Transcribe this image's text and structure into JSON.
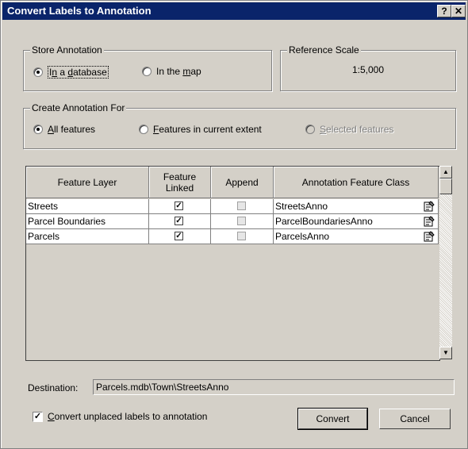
{
  "window": {
    "title": "Convert Labels to Annotation",
    "help_button": "?",
    "close_button": "✕"
  },
  "store_annotation": {
    "legend": "Store Annotation",
    "options": [
      {
        "pre": "I",
        "acc": "n",
        "post": " a ",
        "acc2": "d",
        "post2": "atabase",
        "selected": true
      },
      {
        "pre": "In the ",
        "acc": "m",
        "post": "ap",
        "selected": false
      }
    ]
  },
  "reference_scale": {
    "legend": "Reference Scale",
    "value": "1:5,000"
  },
  "create_for": {
    "legend": "Create Annotation For",
    "options": [
      {
        "acc": "A",
        "post": "ll features",
        "selected": true,
        "enabled": true
      },
      {
        "acc": "F",
        "post": "eatures in current extent",
        "selected": false,
        "enabled": true
      },
      {
        "acc": "S",
        "post": "elected features",
        "selected": false,
        "enabled": false
      }
    ]
  },
  "table": {
    "columns": [
      "Feature Layer",
      "Feature Linked",
      "Append",
      "Annotation Feature Class"
    ],
    "rows": [
      {
        "layer": "Streets",
        "linked": true,
        "append": false,
        "class": "StreetsAnno"
      },
      {
        "layer": "Parcel Boundaries",
        "linked": true,
        "append": false,
        "class": "ParcelBoundariesAnno"
      },
      {
        "layer": "Parcels",
        "linked": true,
        "append": false,
        "class": "ParcelsAnno"
      }
    ]
  },
  "destination": {
    "label": "Destination:",
    "value": "Parcels.mdb\\Town\\StreetsAnno"
  },
  "convert_unplaced": {
    "acc": "C",
    "post": "onvert unplaced labels to annotation",
    "checked": true
  },
  "buttons": {
    "convert": "Convert",
    "cancel": "Cancel"
  }
}
